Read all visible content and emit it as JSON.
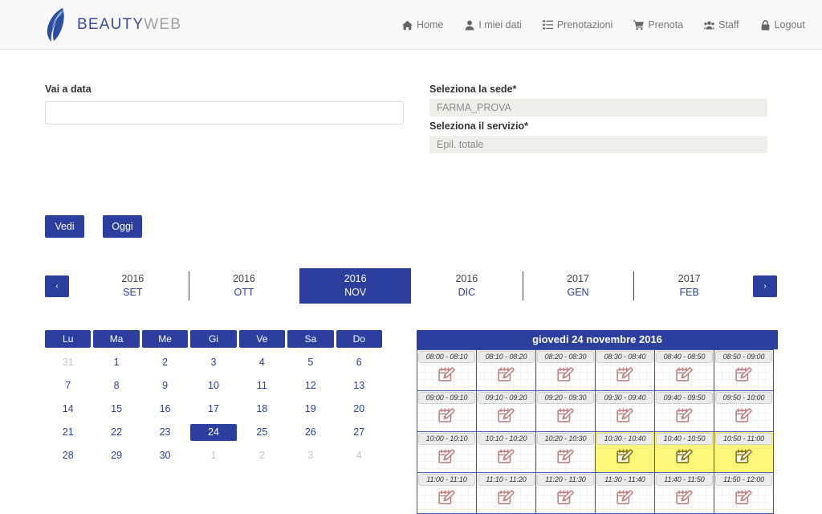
{
  "brand": {
    "logo_icon": "beauty-face-logo",
    "name_primary": "BEAUTY",
    "name_secondary": "WEB"
  },
  "nav": {
    "items": [
      {
        "label": "Home",
        "icon": "home-icon"
      },
      {
        "label": "I miei dati",
        "icon": "user-icon"
      },
      {
        "label": "Prenotazioni",
        "icon": "list-icon"
      },
      {
        "label": "Prenota",
        "icon": "cart-icon"
      },
      {
        "label": "Staff",
        "icon": "users-icon"
      },
      {
        "label": "Logout",
        "icon": "lock-icon"
      }
    ]
  },
  "form": {
    "goto_date_label": "Vai a data",
    "goto_date_value": "",
    "goto_date_placeholder": "",
    "sede_label": "Seleziona la sede*",
    "sede_value": "FARMA_PROVA",
    "servizio_label": "Seleziona il servizio*",
    "servizio_value": "Epil. totale",
    "view_button": "Vedi",
    "today_button": "Oggi"
  },
  "month_strip": {
    "prev_icon": "chevron-left-icon",
    "next_icon": "chevron-right-icon",
    "prev_label": "‹",
    "next_label": "›",
    "months": [
      {
        "year": "2016",
        "month": "SET",
        "active": false,
        "separator": false
      },
      {
        "year": "2016",
        "month": "OTT",
        "active": false,
        "separator": true
      },
      {
        "year": "2016",
        "month": "NOV",
        "active": true,
        "separator": false
      },
      {
        "year": "2016",
        "month": "DIC",
        "active": false,
        "separator": false
      },
      {
        "year": "2017",
        "month": "GEN",
        "active": false,
        "separator": true
      },
      {
        "year": "2017",
        "month": "FEB",
        "active": false,
        "separator": true
      }
    ]
  },
  "calendar": {
    "weekdays": [
      "Lu",
      "Ma",
      "Me",
      "Gi",
      "Ve",
      "Sa",
      "Do"
    ],
    "weeks": [
      [
        {
          "d": "31",
          "muted": true
        },
        {
          "d": "1"
        },
        {
          "d": "2"
        },
        {
          "d": "3"
        },
        {
          "d": "4"
        },
        {
          "d": "5"
        },
        {
          "d": "6"
        }
      ],
      [
        {
          "d": "7"
        },
        {
          "d": "8"
        },
        {
          "d": "9"
        },
        {
          "d": "10"
        },
        {
          "d": "11"
        },
        {
          "d": "12"
        },
        {
          "d": "13"
        }
      ],
      [
        {
          "d": "14"
        },
        {
          "d": "15"
        },
        {
          "d": "16"
        },
        {
          "d": "17"
        },
        {
          "d": "18"
        },
        {
          "d": "19"
        },
        {
          "d": "20"
        }
      ],
      [
        {
          "d": "21"
        },
        {
          "d": "22"
        },
        {
          "d": "23"
        },
        {
          "d": "24",
          "selected": true
        },
        {
          "d": "25"
        },
        {
          "d": "26"
        },
        {
          "d": "27"
        }
      ],
      [
        {
          "d": "28"
        },
        {
          "d": "29"
        },
        {
          "d": "30"
        },
        {
          "d": "1",
          "muted": true
        },
        {
          "d": "2",
          "muted": true
        },
        {
          "d": "3",
          "muted": true
        },
        {
          "d": "4",
          "muted": true
        }
      ]
    ]
  },
  "slots_panel": {
    "title": "giovedi 24 novembre 2016",
    "slot_icon": "calendar-edit-icon",
    "rows": [
      [
        {
          "time": "08:00 - 08:10",
          "busy": false
        },
        {
          "time": "08:10 - 08:20",
          "busy": false
        },
        {
          "time": "08:20 - 08:30",
          "busy": false
        },
        {
          "time": "08:30 - 08:40",
          "busy": false
        },
        {
          "time": "08:40 - 08:50",
          "busy": false
        },
        {
          "time": "08:50 - 09:00",
          "busy": false
        }
      ],
      [
        {
          "time": "09:00 - 09:10",
          "busy": false
        },
        {
          "time": "09:10 - 09:20",
          "busy": false
        },
        {
          "time": "09:20 - 09:30",
          "busy": false
        },
        {
          "time": "09:30 - 09:40",
          "busy": false
        },
        {
          "time": "09:40 - 09:50",
          "busy": false
        },
        {
          "time": "09:50 - 10:00",
          "busy": false
        }
      ],
      [
        {
          "time": "10:00 - 10:10",
          "busy": false
        },
        {
          "time": "10:10 - 10:20",
          "busy": false
        },
        {
          "time": "10:20 - 10:30",
          "busy": false
        },
        {
          "time": "10:30 - 10:40",
          "busy": true
        },
        {
          "time": "10:40 - 10:50",
          "busy": true
        },
        {
          "time": "10:50 - 11:00",
          "busy": true
        }
      ],
      [
        {
          "time": "11:00 - 11:10",
          "busy": false
        },
        {
          "time": "11:10 - 11:20",
          "busy": false
        },
        {
          "time": "11:20 - 11:30",
          "busy": false
        },
        {
          "time": "11:30 - 11:40",
          "busy": false
        },
        {
          "time": "11:40 - 11:50",
          "busy": false
        },
        {
          "time": "11:50 - 12:00",
          "busy": false
        }
      ]
    ]
  },
  "colors": {
    "accent": "#2b3f9e",
    "busy": "#fbf579",
    "navbar_bg": "#f8f8f8",
    "select_bg": "#efefea",
    "icon": "#c08080"
  }
}
